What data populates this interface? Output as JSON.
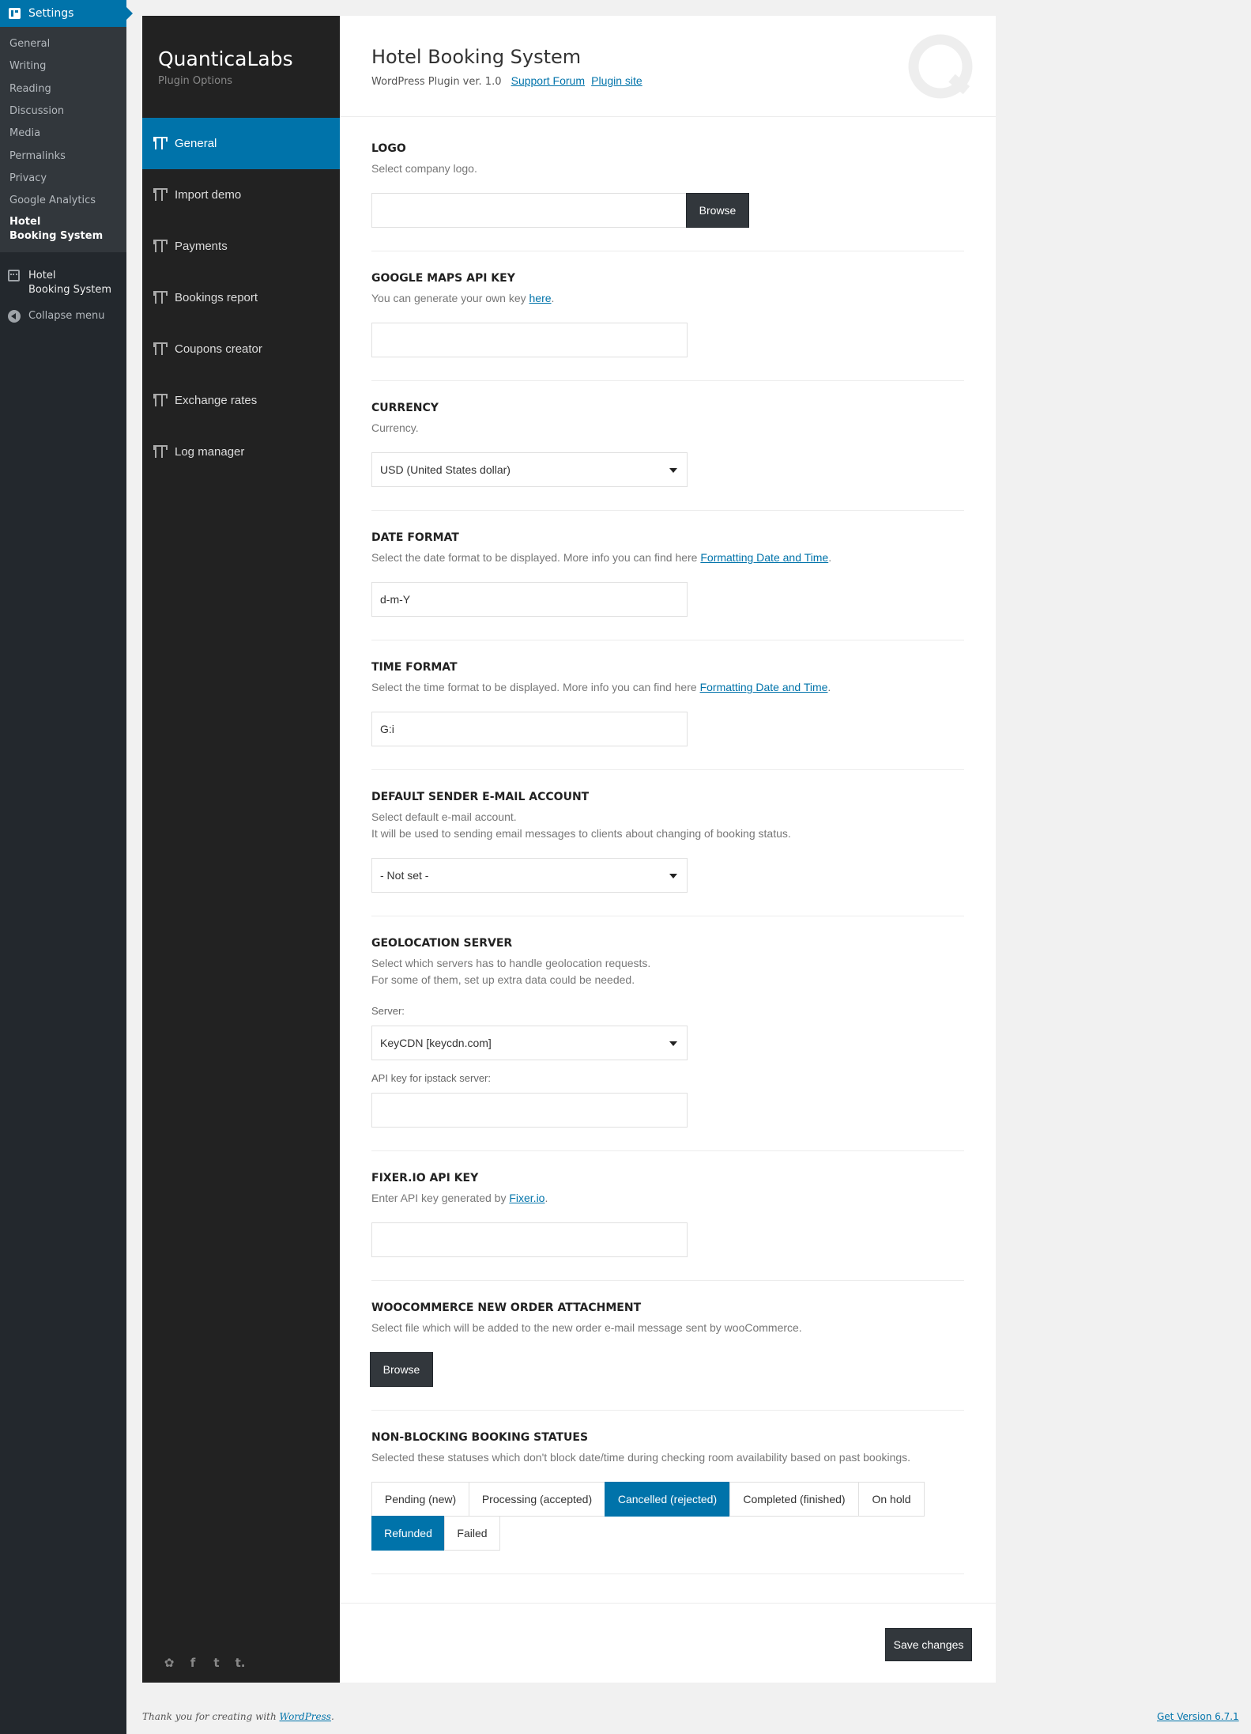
{
  "wp_menu": {
    "settings": "Settings",
    "sub": [
      "General",
      "Writing",
      "Reading",
      "Discussion",
      "Media",
      "Permalinks",
      "Privacy",
      "Google Analytics"
    ],
    "sub_active_line1": "Hotel",
    "sub_active_line2": "Booking System",
    "hotel_line1": "Hotel",
    "hotel_line2": "Booking System",
    "collapse": "Collapse menu"
  },
  "brand": {
    "name": "QuanticaLabs",
    "subtitle": "Plugin Options"
  },
  "plugin_nav": [
    "General",
    "Import demo",
    "Payments",
    "Bookings report",
    "Coupons creator",
    "Exchange rates",
    "Log manager"
  ],
  "header": {
    "title": "Hotel Booking System",
    "subtitle": "WordPress Plugin ver. 1.0",
    "link_support": "Support Forum",
    "link_site": "Plugin site"
  },
  "sections": {
    "logo": {
      "title": "LOGO",
      "desc": "Select company logo.",
      "value": "",
      "browse": "Browse"
    },
    "maps": {
      "title": "GOOGLE MAPS API KEY",
      "desc": "You can generate your own key ",
      "link": "here",
      "after": ".",
      "value": ""
    },
    "currency": {
      "title": "CURRENCY",
      "desc": "Currency.",
      "value": "USD (United States dollar)"
    },
    "date_format": {
      "title": "DATE FORMAT",
      "desc": "Select the date format to be displayed. More info you can find here ",
      "link": "Formatting Date and Time",
      "after": ".",
      "value": "d-m-Y"
    },
    "time_format": {
      "title": "TIME FORMAT",
      "desc": "Select the time format to be displayed. More info you can find here ",
      "link": "Formatting Date and Time",
      "after": ".",
      "value": "G:i"
    },
    "sender": {
      "title": "DEFAULT SENDER E-MAIL ACCOUNT",
      "desc1": "Select default e-mail account.",
      "desc2": "It will be used to sending email messages to clients about changing of booking status.",
      "value": "- Not set -"
    },
    "geo": {
      "title": "GEOLOCATION SERVER",
      "desc1": "Select which servers has to handle geolocation requests.",
      "desc2": "For some of them, set up extra data could be needed.",
      "server_label": "Server:",
      "server_value": "KeyCDN [keycdn.com]",
      "api_label": "API key for ipstack server:",
      "api_value": ""
    },
    "fixer": {
      "title": "FIXER.IO API KEY",
      "desc": "Enter API key generated by ",
      "link": "Fixer.io",
      "after": ".",
      "value": ""
    },
    "woo": {
      "title": "WOOCOMMERCE NEW ORDER ATTACHMENT",
      "desc": "Select file which will be added to the new order e-mail message sent by wooCommerce.",
      "browse": "Browse"
    },
    "statuses": {
      "title": "NON-BLOCKING BOOKING STATUES",
      "desc": "Selected these statuses which don't block date/time during checking room availability based on past bookings.",
      "items": [
        {
          "label": "Pending (new)",
          "selected": false
        },
        {
          "label": "Processing (accepted)",
          "selected": false
        },
        {
          "label": "Cancelled (rejected)",
          "selected": true
        },
        {
          "label": "Completed (finished)",
          "selected": false
        },
        {
          "label": "On hold",
          "selected": false
        },
        {
          "label": "Refunded",
          "selected": true
        },
        {
          "label": "Failed",
          "selected": false
        }
      ]
    }
  },
  "save": "Save changes",
  "footer": {
    "text": "Thank you for creating with ",
    "link": "WordPress",
    "after": ".",
    "version": "Get Version 6.7.1"
  },
  "colors": {
    "accent": "#0073aa",
    "sidebar": "#23282d",
    "panel": "#222222"
  }
}
